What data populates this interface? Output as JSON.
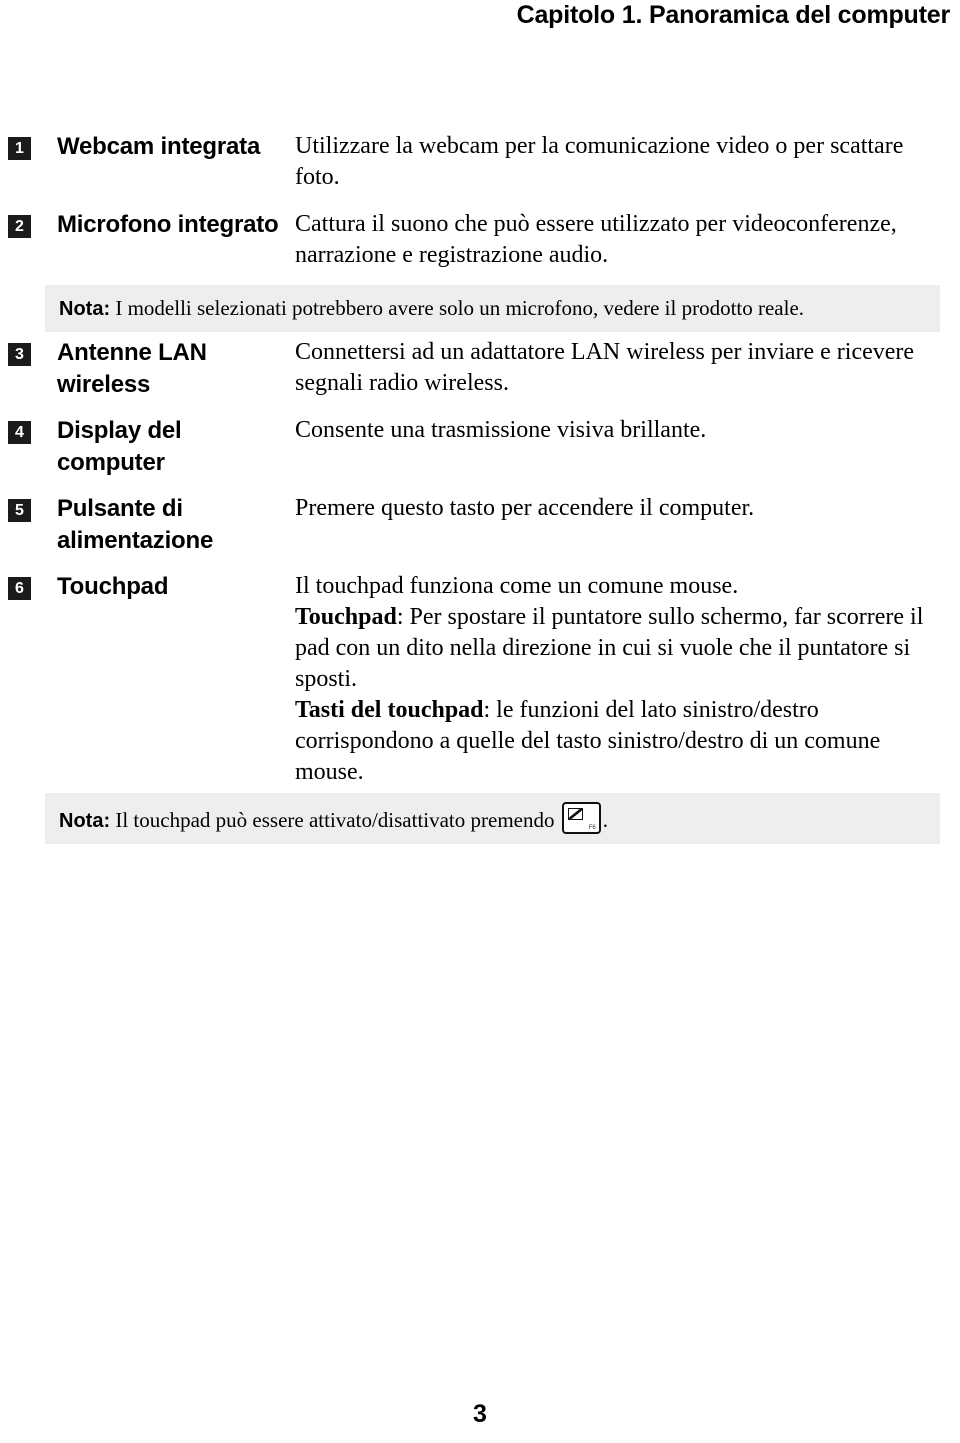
{
  "header": {
    "chapter_title": "Capitolo 1. Panoramica del computer"
  },
  "table": {
    "rows": [
      {
        "number": "1",
        "label": "Webcam integrata",
        "description": "Utilizzare la webcam per la comunicazione video o per scattare foto."
      },
      {
        "number": "2",
        "label": "Microfono integrato",
        "description": "Cattura il suono che può essere utilizzato per videoconferenze, narrazione e registrazione audio."
      },
      {
        "number": "3",
        "label": "Antenne LAN wireless",
        "description": "Connettersi ad un adattatore LAN wireless per inviare e ricevere segnali radio wireless."
      },
      {
        "number": "4",
        "label": "Display del computer",
        "description": "Consente una trasmissione visiva brillante."
      },
      {
        "number": "5",
        "label": "Pulsante di alimentazione",
        "description": "Premere questo tasto per accendere il computer."
      },
      {
        "number": "6",
        "label": "Touchpad",
        "description_line1": "Il touchpad funziona come un comune mouse.",
        "description_touchpad_lead": "Touchpad",
        "description_touchpad_body": ": Per spostare il puntatore sullo schermo, far scorrere il pad con un dito nella direzione in cui si vuole che il puntatore si sposti.",
        "description_keys_lead": "Tasti del touchpad",
        "description_keys_body": ": le funzioni del lato sinistro/destro corrispondono a quelle del tasto sinistro/destro di un comune mouse."
      }
    ]
  },
  "notes": {
    "microphone": {
      "word": "Nota:",
      "text": " I modelli selezionati potrebbero avere solo un microfono, vedere il prodotto reale."
    },
    "touchpad": {
      "word": "Nota:",
      "text_before_key": " Il touchpad può essere attivato/disattivato premendo ",
      "key_label": "F6",
      "text_after_key": "."
    }
  },
  "footer": {
    "page_number": "3"
  },
  "colors": {
    "badge_background": "#1b1b1b",
    "badge_text": "#ffffff",
    "note_background": "#eeeeee",
    "page_background": "#ffffff",
    "text": "#000000"
  }
}
